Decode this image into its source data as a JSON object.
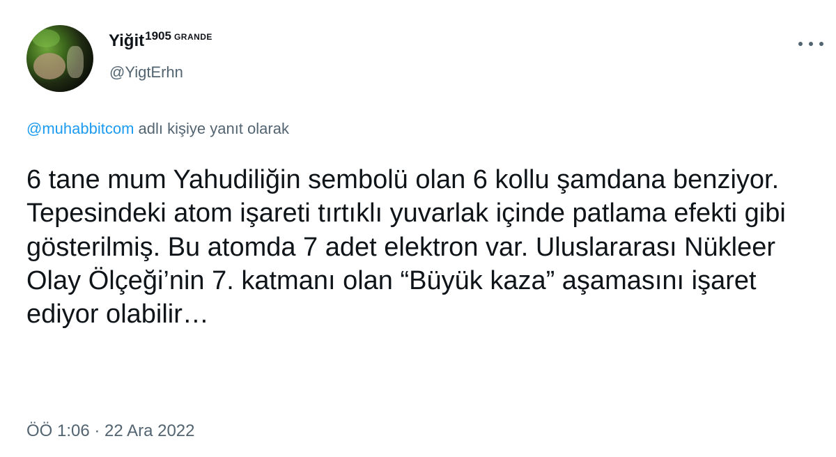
{
  "author": {
    "display_name": "Yiğit",
    "name_superscript": "1905",
    "name_tag": "GRANDE",
    "handle": "@YigtErhn"
  },
  "icons": {
    "more": "more-horizontal-icon"
  },
  "reply_context": {
    "mention": "@muhabbitcom",
    "text": " adlı kişiye yanıt olarak"
  },
  "tweet": {
    "text": "6 tane mum Yahudiliğin sembolü olan 6 kollu şamdana benziyor. Tepesindeki atom işareti tırtıklı yuvarlak içinde patlama efekti gibi gösterilmiş. Bu atomda 7 adet elektron var. Uluslararası Nükleer Olay Ölçeği’nin 7. katmanı olan “Büyük kaza” aşamasını işaret ediyor olabilir…",
    "time": "ÖÖ 1:06",
    "separator": " · ",
    "date": "22 Ara 2022"
  },
  "colors": {
    "text_primary": "#0f1419",
    "text_secondary": "#536471",
    "link": "#1d9bf0"
  }
}
